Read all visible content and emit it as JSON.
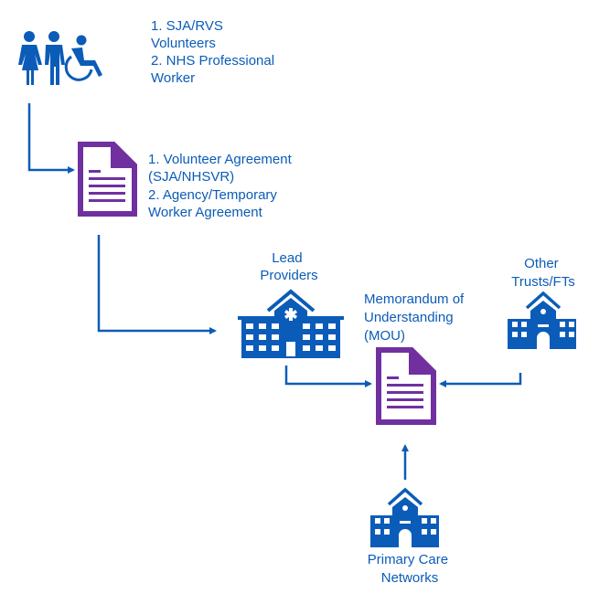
{
  "colors": {
    "primary_blue": "#0b5cb8",
    "document_purple": "#7030a0"
  },
  "people": {
    "icon": "people-with-wheelchair-icon",
    "lines": [
      "1. SJA/RVS",
      "Volunteers",
      "2. NHS Professional",
      "Worker"
    ]
  },
  "agreement": {
    "icon": "document-icon",
    "lines": [
      "1. Volunteer Agreement",
      "(SJA/NHSVR)",
      "2. Agency/Temporary",
      "Worker Agreement"
    ]
  },
  "lead_providers": {
    "icon": "hospital-icon",
    "lines": [
      "Lead",
      "Providers"
    ]
  },
  "mou": {
    "icon": "document-icon",
    "lines": [
      "Memorandum of",
      "Understanding",
      "(MOU)"
    ]
  },
  "other_trusts": {
    "icon": "building-icon",
    "lines": [
      "Other",
      "Trusts/FTs"
    ]
  },
  "primary_care": {
    "icon": "building-icon",
    "lines": [
      "Primary Care",
      "Networks"
    ]
  }
}
